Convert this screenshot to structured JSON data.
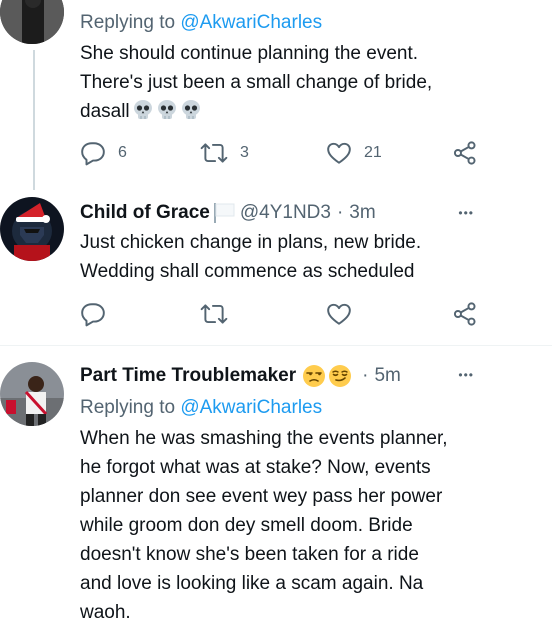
{
  "tweet1": {
    "replying_prefix": "Replying to",
    "replying_handle": "@AkwariCharles",
    "text_lines": [
      "She should continue planning the event.",
      "There's just been a small change of bride,",
      "dasall"
    ],
    "reply_count": "6",
    "retweet_count": "3",
    "like_count": "21"
  },
  "tweet2": {
    "display_name": "Child of Grace",
    "handle": "@4Y1ND3",
    "time": "3m",
    "text_lines": [
      "Just chicken change in plans, new bride.",
      "Wedding shall commence as scheduled"
    ]
  },
  "tweet3": {
    "display_name": "Part Time Troublemaker",
    "time": "5m",
    "replying_prefix": "Replying to",
    "replying_handle": "@AkwariCharles",
    "text_lines": [
      "When he was smashing the events planner,",
      "he forgot what was at stake? Now, events",
      "planner don see event wey pass her power",
      "while groom don dey smell doom. Bride",
      "doesn't know she's been taken for a ride",
      "and love is looking like a scam again. Na",
      "waoh."
    ]
  },
  "separator": "·",
  "more_glyph": "•••",
  "colors": {
    "link": "#1d9bf0",
    "muted": "#536471",
    "text": "#0f1419",
    "divider": "#eff3f4",
    "thread": "#cfd9de"
  }
}
